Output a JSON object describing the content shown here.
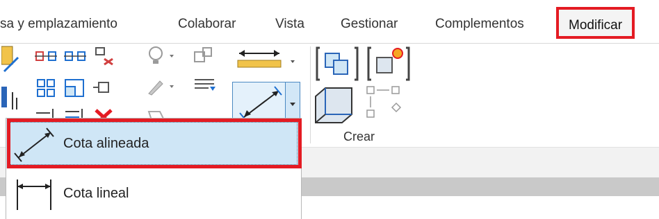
{
  "tabs": [
    {
      "label": "sa y emplazamiento"
    },
    {
      "label": "Colaborar"
    },
    {
      "label": "Vista"
    },
    {
      "label": "Gestionar"
    },
    {
      "label": "Complementos"
    },
    {
      "label": "Modificar"
    }
  ],
  "panels": {
    "create_label": "Crear"
  },
  "dropdown": {
    "items": [
      {
        "label": "Cota alineada",
        "icon": "aligned-dimension-icon"
      },
      {
        "label": "Cota lineal",
        "icon": "linear-dimension-icon"
      }
    ]
  },
  "colors": {
    "highlight_red": "#e41b23",
    "selected_blue": "#cfe6f6",
    "accent_blue": "#1e6fd0"
  }
}
